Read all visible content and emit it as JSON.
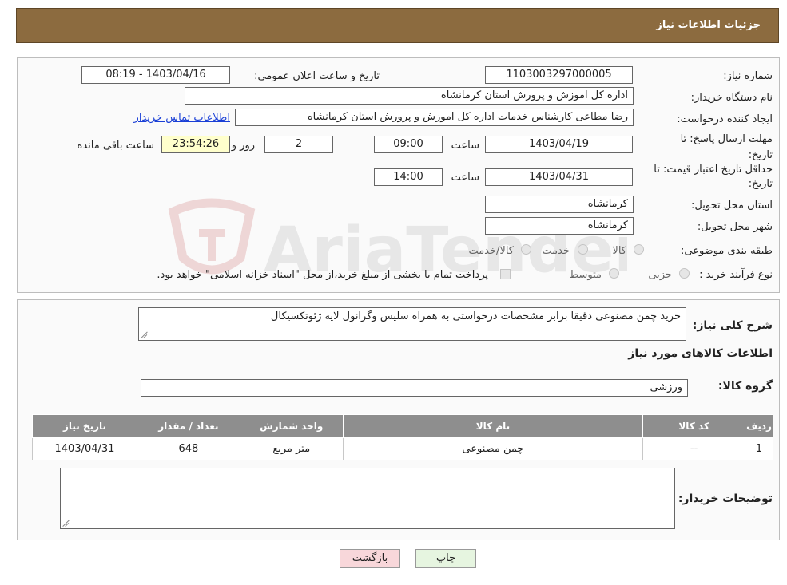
{
  "header": {
    "title": "جزئیات اطلاعات نیاز"
  },
  "fields": {
    "need_number_label": "شماره نیاز:",
    "need_number": "1103003297000005",
    "announce_label": "تاریخ و ساعت اعلان عمومی:",
    "announce_value": "1403/04/16 - 08:19",
    "buyer_org_label": "نام دستگاه خریدار:",
    "buyer_org": "اداره کل اموزش و پرورش استان کرمانشاه",
    "requester_label": "ایجاد کننده درخواست:",
    "requester": "رضا مطاعی کارشناس خدمات اداره کل اموزش و پرورش استان کرمانشاه",
    "contact_link": "اطلاعات تماس خریدار",
    "deadline_label": "مهلت ارسال پاسخ: تا تاریخ:",
    "deadline_date": "1403/04/19",
    "time_label": "ساعت",
    "deadline_time": "09:00",
    "days": "2",
    "days_label": "روز و",
    "remaining": "23:54:26",
    "remaining_label": "ساعت باقی مانده",
    "validity_label": "حداقل تاریخ اعتبار قیمت: تا تاریخ:",
    "validity_date": "1403/04/31",
    "validity_time": "14:00",
    "province_label": "استان محل تحویل:",
    "province": "کرمانشاه",
    "city_label": "شهر محل تحویل:",
    "city": "کرمانشاه",
    "category_label": "طبقه بندی موضوعی:",
    "category_options": [
      "کالا",
      "خدمت",
      "کالا/خدمت"
    ],
    "process_label": "نوع فرآیند خرید :",
    "process_options": [
      "جزیی",
      "متوسط"
    ],
    "payment_note": "پرداخت تمام یا بخشی از مبلغ خرید،از محل \"اسناد خزانه اسلامی\" خواهد بود."
  },
  "details": {
    "description_label": "شرح کلی نیاز:",
    "description": "خرید چمن مصنوعی دقیقا برابر مشخصات درخواستی به همراه سلیس وگرانول لایه ژئوتکسیکال",
    "goods_info_title": "اطلاعات کالاهای مورد نیاز",
    "goods_group_label": "گروه کالا:",
    "goods_group": "ورزشی",
    "table": {
      "headers": [
        "ردیف",
        "کد کالا",
        "نام کالا",
        "واحد شمارش",
        "تعداد / مقدار",
        "تاریخ نیاز"
      ],
      "rows": [
        [
          "1",
          "--",
          "چمن مصنوعی",
          "متر مربع",
          "648",
          "1403/04/31"
        ]
      ]
    },
    "buyer_notes_label": "توضیحات خریدار:",
    "buyer_notes": ""
  },
  "buttons": {
    "print": "چاپ",
    "back": "بازگشت"
  },
  "watermark": {
    "text": "AriaTender.neT"
  },
  "colors": {
    "header": "#8c6b3f",
    "table_header": "#8e8e8e",
    "link": "#1a3fd6",
    "back_button": "#f8d7da",
    "print_button": "#e6f5e0"
  }
}
